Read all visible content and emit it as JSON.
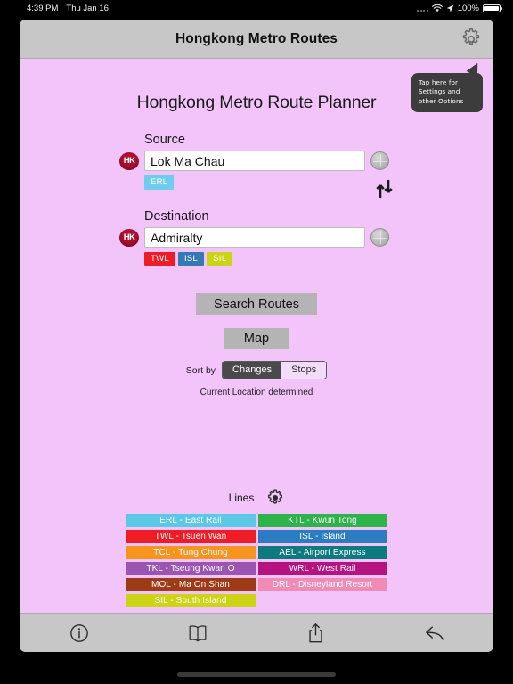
{
  "status_bar": {
    "time": "4:39 PM",
    "date": "Thu Jan 16",
    "battery_percent": "100%",
    "wifi_icon": "wifi-icon",
    "location_icon": "location-arrow-icon",
    "battery_icon": "battery-icon"
  },
  "navbar": {
    "title": "Hongkong Metro Routes",
    "gear_icon": "gear-icon"
  },
  "tooltip": {
    "text": "Tap here for Settings and other Options"
  },
  "page": {
    "title": "Hongkong Metro Route Planner"
  },
  "source": {
    "label": "Source",
    "value": "Lok Ma Chau",
    "placeholder": "Source",
    "hk_badge": "HK",
    "globe_icon": "globe-icon",
    "lines": [
      {
        "code": "ERL",
        "color": "#6ecdef"
      }
    ]
  },
  "destination": {
    "label": "Destination",
    "value": "Admiralty",
    "placeholder": "Destination",
    "hk_badge": "HK",
    "globe_icon": "globe-icon",
    "lines": [
      {
        "code": "TWL",
        "color": "#ee1c25"
      },
      {
        "code": "ISL",
        "color": "#3479b6"
      },
      {
        "code": "SIL",
        "color": "#cbd415"
      }
    ]
  },
  "swap": {
    "icon": "swap-arrows-icon"
  },
  "actions": {
    "search_routes_label": "Search Routes",
    "map_label": "Map"
  },
  "sort": {
    "label": "Sort by",
    "options": [
      {
        "label": "Changes",
        "selected": true
      },
      {
        "label": "Stops",
        "selected": false
      }
    ]
  },
  "status_message": "Current Location determined",
  "lines_section": {
    "title": "Lines",
    "gear_icon": "gear-icon",
    "left_column": [
      {
        "label": "ERL - East Rail",
        "color": "#5bc8e8"
      },
      {
        "label": "TWL - Tsuen Wan",
        "color": "#ee1c25"
      },
      {
        "label": "TCL - Tung Chung",
        "color": "#f7941e"
      },
      {
        "label": "TKL - Tseung Kwan O",
        "color": "#9a55b0"
      },
      {
        "label": "MOL - Ma On Shan",
        "color": "#9c3b16"
      },
      {
        "label": "SIL - South Island",
        "color": "#cbd415"
      }
    ],
    "right_column": [
      {
        "label": "KTL - Kwun Tong",
        "color": "#2eb24a"
      },
      {
        "label": "ISL - Island",
        "color": "#2b7cc1"
      },
      {
        "label": "AEL - Airport Express",
        "color": "#0d7a7f"
      },
      {
        "label": "WRL - West Rail",
        "color": "#b5137f"
      },
      {
        "label": "DRL - Disneyland Resort",
        "color": "#ef8bb5"
      }
    ]
  },
  "toolbar": {
    "items": [
      {
        "name": "info-icon"
      },
      {
        "name": "book-icon"
      },
      {
        "name": "share-icon"
      },
      {
        "name": "reply-icon"
      }
    ]
  },
  "colors": {
    "background": "#f2c4fa",
    "chrome": "#c7c7c7",
    "accent_button": "#b4b4b4",
    "segment_active": "#4a4a4a"
  }
}
